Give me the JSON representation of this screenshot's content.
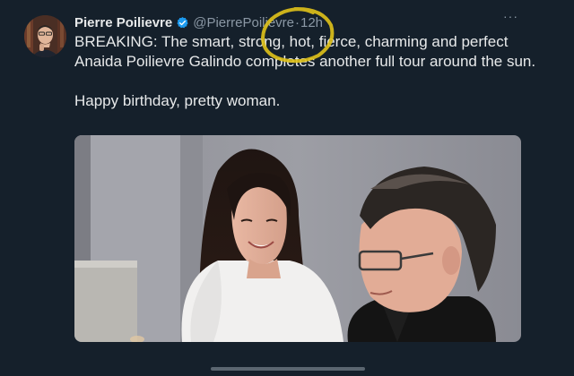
{
  "tweet": {
    "author_name": "Pierre Poilievre",
    "handle": "@PierrePoilievre",
    "separator": "·",
    "time": "12h",
    "more_label": "···",
    "text_line1": "BREAKING: The smart, strong, hot, fierce, charming and perfect Anaida Poilievre Galindo completes another full tour around the sun.",
    "text_line2": "Happy birthday, pretty woman."
  },
  "icons": {
    "verified": "verified-badge-icon",
    "more": "more-options-icon"
  },
  "colors": {
    "background": "#15202b",
    "text": "#e7e9ea",
    "muted": "#8b98a5",
    "verified": "#1d9bf0",
    "annotation": "#e0c21a"
  }
}
